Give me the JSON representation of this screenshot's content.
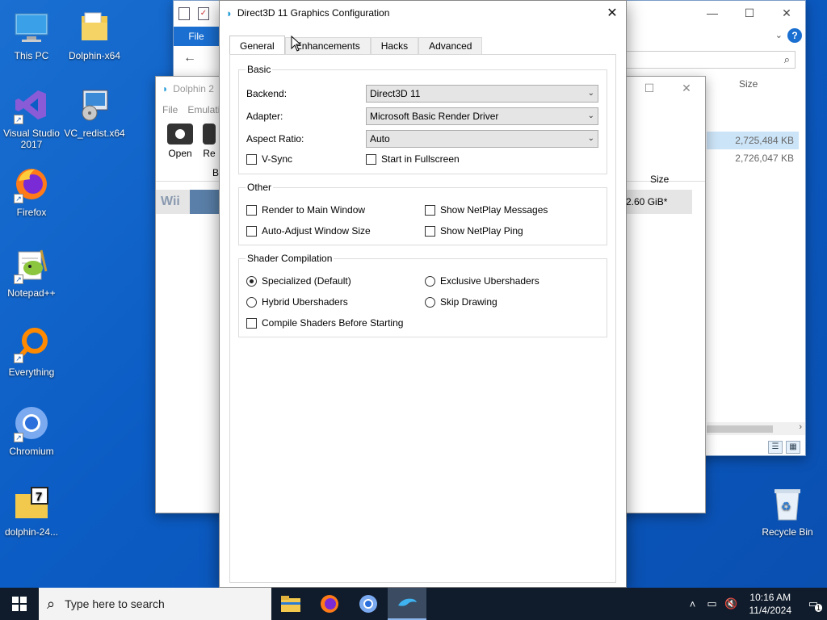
{
  "desktop": {
    "icons": [
      {
        "label": "This PC"
      },
      {
        "label": "Dolphin-x64"
      },
      {
        "label": "Visual Studio 2017"
      },
      {
        "label": "VC_redist.x64"
      },
      {
        "label": "Firefox"
      },
      {
        "label": "Notepad++"
      },
      {
        "label": "Everything"
      },
      {
        "label": "Chromium"
      },
      {
        "label": "dolphin-24..."
      },
      {
        "label": "Recycle Bin"
      }
    ]
  },
  "explorer": {
    "file_tab": "File",
    "column_size": "Size",
    "rows": [
      "2,725,484 KB",
      "2,726,047 KB"
    ]
  },
  "dolphin": {
    "title": "Dolphin 2",
    "menu": [
      "File",
      "Emulati"
    ],
    "toolbar": {
      "open": "Open",
      "re": "Re"
    },
    "col_b": "B",
    "col_size": "Size",
    "row": {
      "platform": "Wii",
      "size": "2.60 GiB*"
    }
  },
  "gfx": {
    "title": "Direct3D 11 Graphics Configuration",
    "tabs": [
      "General",
      "Enhancements",
      "Hacks",
      "Advanced"
    ],
    "basic": {
      "legend": "Basic",
      "backend_label": "Backend:",
      "backend_value": "Direct3D 11",
      "adapter_label": "Adapter:",
      "adapter_value": "Microsoft Basic Render Driver",
      "aspect_label": "Aspect Ratio:",
      "aspect_value": "Auto",
      "vsync": "V-Sync",
      "fullscreen": "Start in Fullscreen"
    },
    "other": {
      "legend": "Other",
      "render_main": "Render to Main Window",
      "netplay_msgs": "Show NetPlay Messages",
      "auto_adjust": "Auto-Adjust Window Size",
      "netplay_ping": "Show NetPlay Ping"
    },
    "shader": {
      "legend": "Shader Compilation",
      "specialized": "Specialized (Default)",
      "exclusive": "Exclusive Ubershaders",
      "hybrid": "Hybrid Ubershaders",
      "skip": "Skip Drawing",
      "compile_before": "Compile Shaders Before Starting",
      "selected": "specialized"
    }
  },
  "taskbar": {
    "search_placeholder": "Type here to search",
    "time": "10:16 AM",
    "date": "11/4/2024",
    "notification_count": "1"
  },
  "colors": {
    "desktop": "#0b5cc4",
    "accent": "#1a6fd1",
    "taskbar": "#101c2c"
  }
}
